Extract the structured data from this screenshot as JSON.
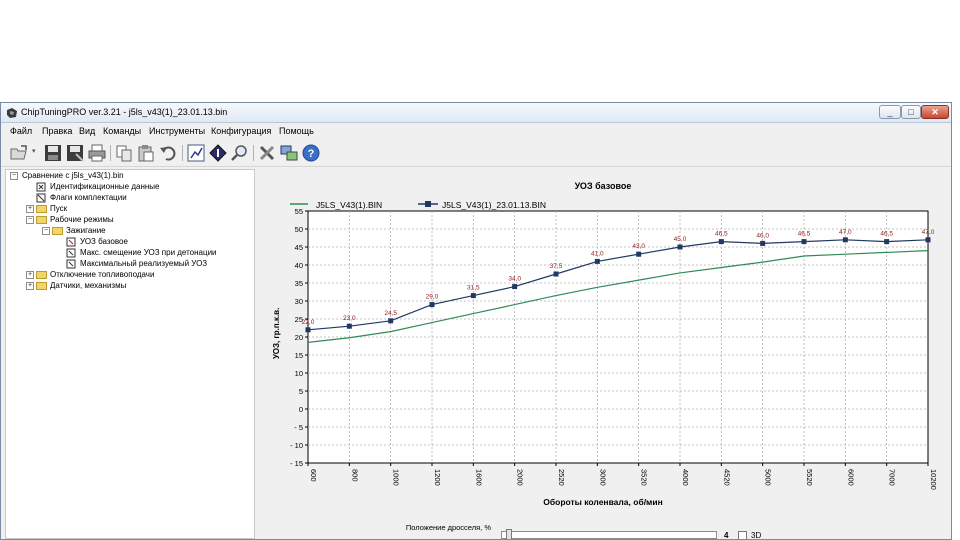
{
  "window": {
    "title": "ChipTuningPRO ver.3.21 - j5ls_v43(1)_23.01.13.bin",
    "controls": [
      "_",
      "□",
      "✕"
    ]
  },
  "menu": [
    "Файл",
    "Правка",
    "Вид",
    "Команды",
    "Инструменты",
    "Конфигурация",
    "Помощь"
  ],
  "toolbar": [
    "open-icon",
    "save-icon",
    "save-as-icon",
    "print-icon",
    "copy-icon",
    "paste-icon",
    "undo-icon",
    "chart-icon",
    "diamond-icon",
    "search-icon",
    "tools-icon",
    "network-icon",
    "help-icon"
  ],
  "tree": {
    "root": "Сравнение с j5ls_v43(1).bin",
    "ident": "Идентификационные данные",
    "flags": "Флаги комплектации",
    "start": "Пуск",
    "modes": "Рабочие режимы",
    "ignition": "Зажигание",
    "uoz_base": "УОЗ базовое",
    "max_shift": "Макс. смещение УОЗ при детонации",
    "max_real": "Максимальный реализуемый УОЗ",
    "fuel_cut": "Отключение топливоподачи",
    "sensors": "Датчики, механизмы"
  },
  "throttle": {
    "label": "Положение дросселя, %",
    "value": "4",
    "checkbox_3d": "3D"
  },
  "chart_data": {
    "type": "line",
    "title": "УОЗ базовое",
    "xlabel": "Обороты коленвала, об/мин",
    "ylabel": "УОЗ, гр.п.к.в.",
    "categories": [
      "600",
      "800",
      "1000",
      "1200",
      "1600",
      "2000",
      "2520",
      "3000",
      "3520",
      "4000",
      "4520",
      "5000",
      "5520",
      "6000",
      "7000",
      "10200"
    ],
    "yticks": [
      "55",
      "50",
      "45",
      "40",
      "35",
      "30",
      "25",
      "20",
      "15",
      "10",
      "5",
      "0",
      "- 5",
      "- 10",
      "- 15"
    ],
    "ylim": [
      -15,
      55
    ],
    "grid": true,
    "legend_position": "top-left",
    "series": [
      {
        "name": "J5LS_V43(1).BIN",
        "color": "#2e8b57",
        "marker": "none",
        "values": [
          18.5,
          19.8,
          21.5,
          24.0,
          26.5,
          29.0,
          31.5,
          33.8,
          35.8,
          37.8,
          39.3,
          40.8,
          42.5,
          43.0,
          43.5,
          44.0
        ]
      },
      {
        "name": "J5LS_V43(1)_23.01.13.BIN",
        "color": "#1f3864",
        "marker": "square",
        "values": [
          22.0,
          23.0,
          24.5,
          29.0,
          31.5,
          34.0,
          37.5,
          41.0,
          43.0,
          45.0,
          46.5,
          46.0,
          46.5,
          47.0,
          46.5,
          47.0
        ],
        "labels": [
          "22,0",
          "23,0",
          "24,5",
          "29,0",
          "31,5",
          "34,0",
          "37,5",
          "41,0",
          "43,0",
          "45,0",
          "46,5",
          "46,0",
          "46,5",
          "47,0",
          "46,5",
          "47,0"
        ]
      }
    ]
  }
}
